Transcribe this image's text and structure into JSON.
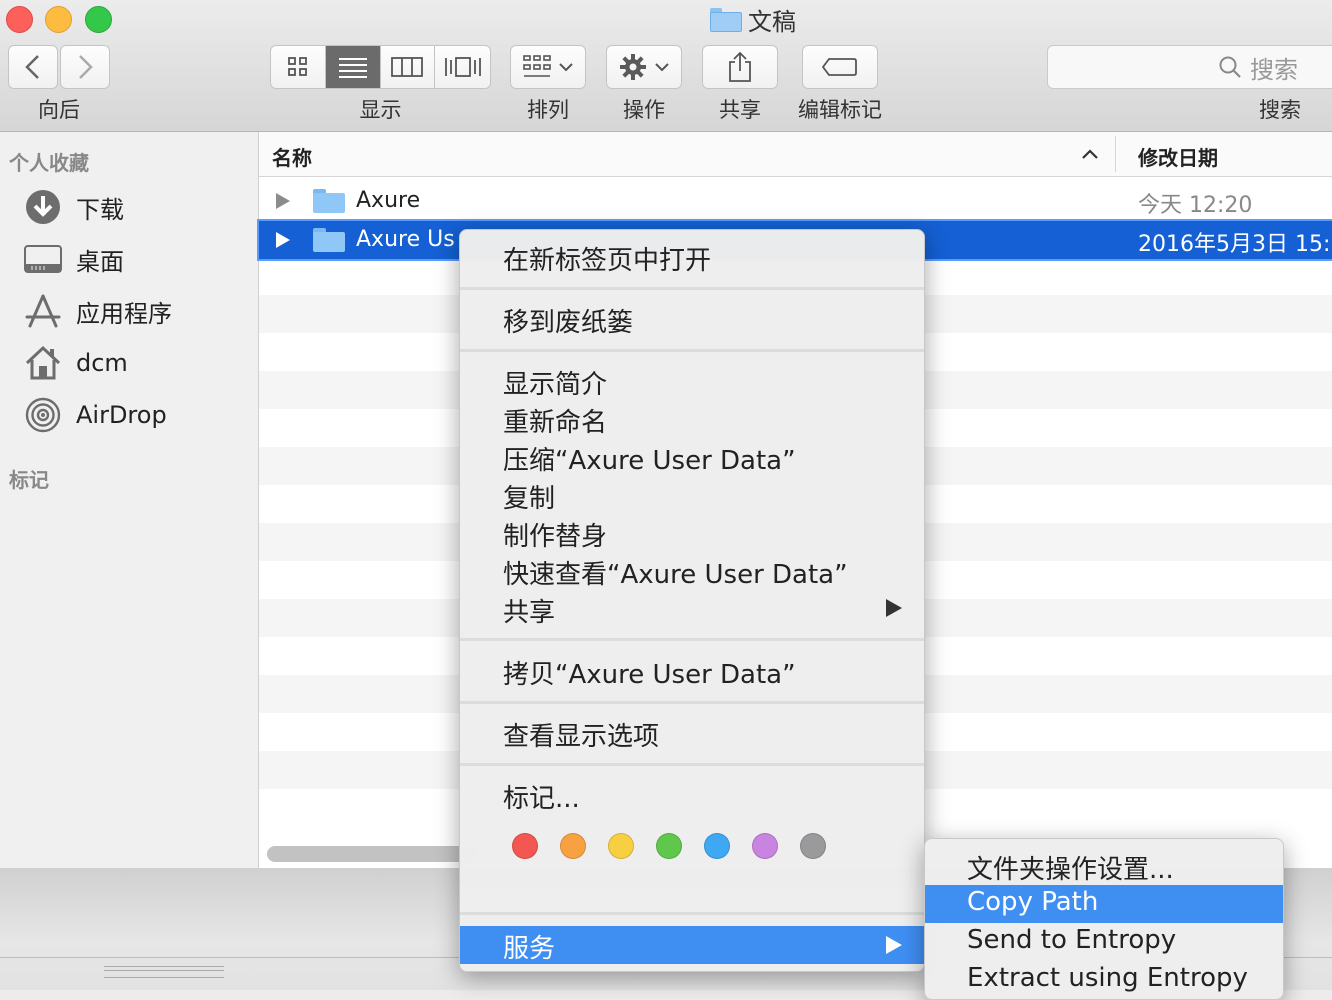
{
  "window": {
    "title": "文稿"
  },
  "toolbar": {
    "back_label": "向后",
    "view_label": "显示",
    "arrange_label": "排列",
    "action_label": "操作",
    "share_label": "共享",
    "tags_label": "编辑标记",
    "search_label": "搜索",
    "search_placeholder": "搜索",
    "active_view": "list"
  },
  "sidebar": {
    "favorites_header": "个人收藏",
    "items": [
      {
        "label": "下载",
        "icon": "download-icon"
      },
      {
        "label": "桌面",
        "icon": "desktop-icon"
      },
      {
        "label": "应用程序",
        "icon": "applications-icon"
      },
      {
        "label": "dcm",
        "icon": "home-icon"
      },
      {
        "label": "AirDrop",
        "icon": "airdrop-icon"
      }
    ],
    "tags_header": "标记"
  },
  "list": {
    "col_name": "名称",
    "col_date": "修改日期",
    "rows": [
      {
        "name": "Axure",
        "date": "今天 12:20",
        "selected": false
      },
      {
        "name": "Axure Us",
        "date": "2016年5月3日 15:",
        "selected": true
      }
    ]
  },
  "context_menu": {
    "open_new_tab": "在新标签页中打开",
    "move_trash": "移到废纸篓",
    "get_info": "显示简介",
    "rename": "重新命名",
    "compress": "压缩“Axure User Data”",
    "duplicate": "复制",
    "make_alias": "制作替身",
    "quick_look": "快速查看“Axure User Data”",
    "share": "共享",
    "copy_item": "拷贝“Axure User Data”",
    "view_options": "查看显示选项",
    "tags": "标记...",
    "tag_colors": [
      "#f45752",
      "#f7a142",
      "#f8cf41",
      "#5fc84c",
      "#3fa8f3",
      "#c884e0",
      "#9a9a9c"
    ],
    "services": "服务"
  },
  "services_menu": {
    "items": [
      "文件夹操作设置...",
      "Copy Path",
      "Send to Entropy",
      "Extract using Entropy"
    ],
    "highlighted": "Copy Path"
  }
}
